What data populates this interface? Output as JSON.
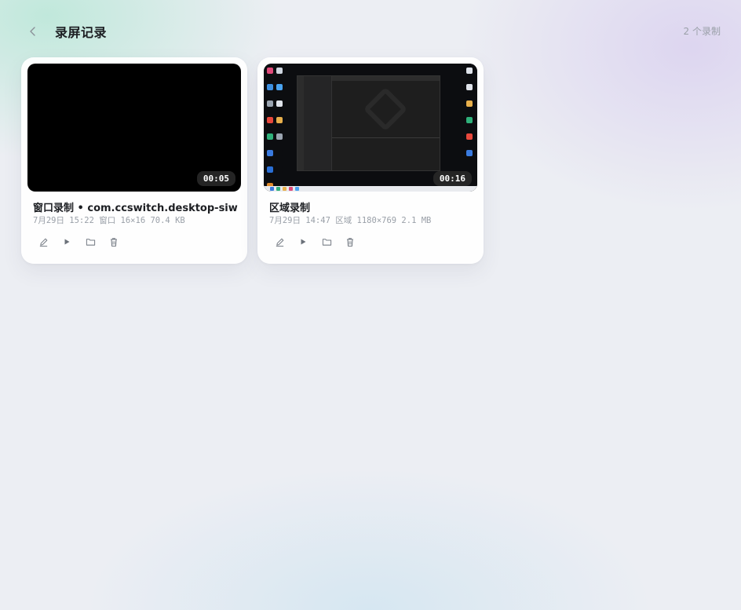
{
  "header": {
    "title": "录屏记录",
    "count": "2 个录制",
    "back_icon": "chevron-left-icon"
  },
  "colors": {
    "accent_text": "#1c1e22",
    "muted_text": "#9aa0a8",
    "card_bg": "#ffffff",
    "badge_bg": "#282828"
  },
  "recordings": [
    {
      "title": "窗口录制 • com.ccswitch.desktop-siw",
      "meta": "7月29日 15:22 窗口 16×16 70.4 KB",
      "duration": "00:05",
      "actions": [
        "edit-icon",
        "play-icon",
        "folder-icon",
        "trash-icon"
      ]
    },
    {
      "title": "区域录制",
      "meta": "7月29日 14:47 区域 1180×769 2.1 MB",
      "duration": "00:16",
      "actions": [
        "edit-icon",
        "play-icon",
        "folder-icon",
        "trash-icon"
      ]
    }
  ]
}
